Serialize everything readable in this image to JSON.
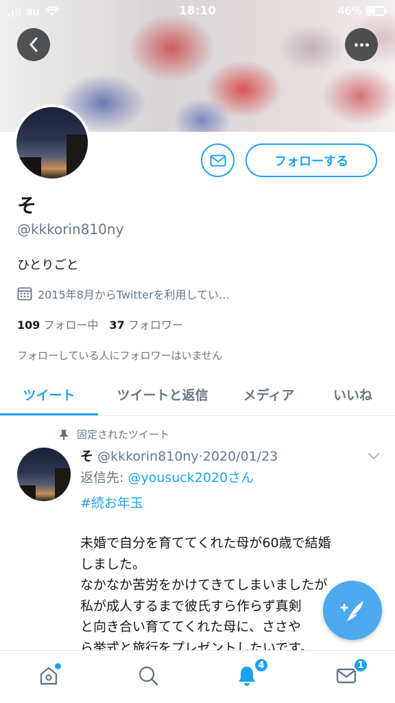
{
  "status_bar": {
    "carrier": "au",
    "time": "18:10",
    "battery_text": "46%",
    "battery_level": 0.46
  },
  "profile": {
    "display_name": "そ",
    "handle": "@kkkorin810ny",
    "bio": "ひとりごと",
    "joined": "2015年8月からTwitterを利用してい…",
    "following_count": "109",
    "following_label": "フォロー中",
    "followers_count": "37",
    "followers_label": "フォロワー",
    "no_mutual_followers": "フォローしている人にフォロワーはいません",
    "follow_button": "フォローする"
  },
  "tabs": [
    {
      "label": "ツイート",
      "active": true
    },
    {
      "label": "ツイートと返信",
      "active": false
    },
    {
      "label": "メディア",
      "active": false
    },
    {
      "label": "いいね",
      "active": false
    }
  ],
  "tweet": {
    "pinned_label": "固定されたツイート",
    "author_name": "そ",
    "author_handle": "@kkkorin810ny",
    "separator": "·",
    "date": "2020/01/23",
    "reply_prefix": "返信先: ",
    "reply_to": "@yousuck2020さん",
    "hashtag": "#続お年玉",
    "lines": [
      "未婚で自分を育ててくれた母が60歳で結婚",
      "しました。",
      "なかなか苦労をかけてきてしまいましたが",
      "私が成人するまで彼氏すら作らず真剣",
      "と向き合い育ててくれた母に、ささや",
      "ら挙式と旅行をプレゼントしたいです。"
    ]
  },
  "bottom_nav": {
    "notifications_badge": "4",
    "messages_badge": "1"
  },
  "colors": {
    "accent": "#1da1f2",
    "secondary_text": "#657786",
    "fab": "#4ba9ee"
  }
}
